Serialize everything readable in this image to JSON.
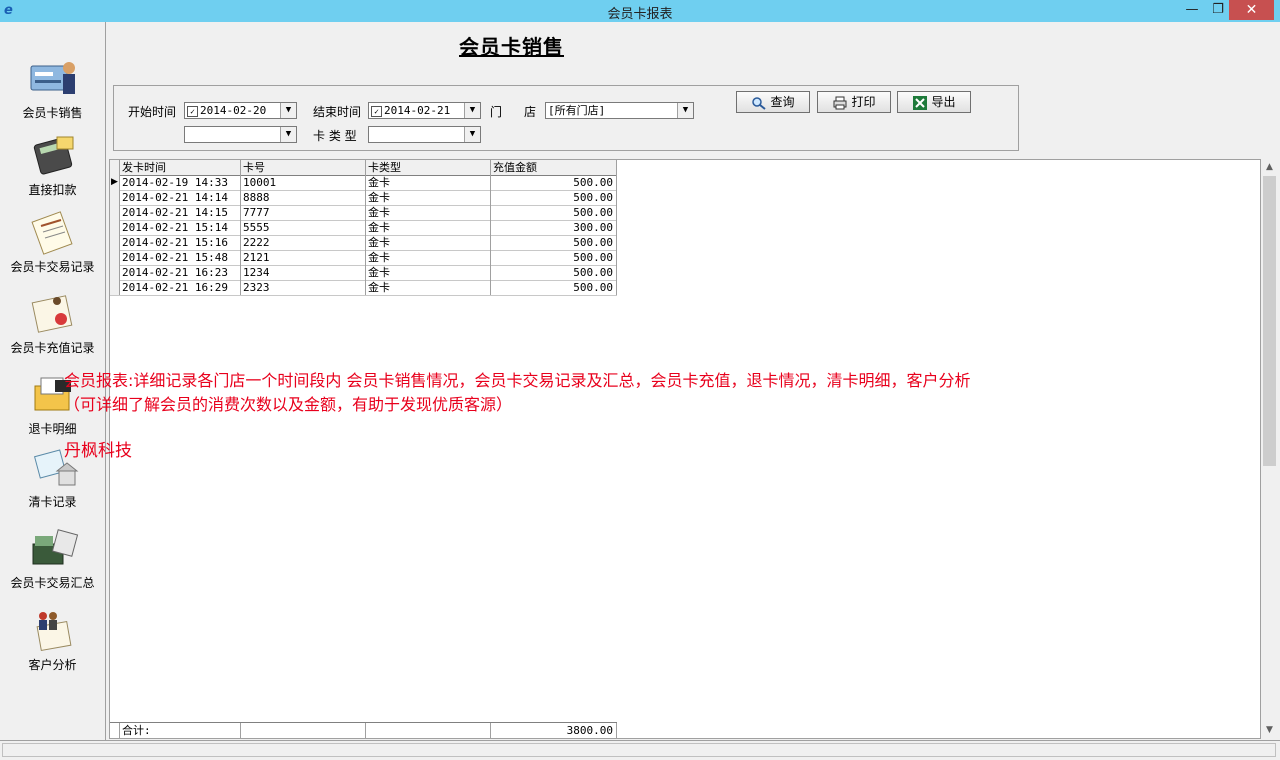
{
  "window": {
    "title": "会员卡报表",
    "minimize": "—",
    "restore": "❐",
    "close": "✕"
  },
  "sidebar": {
    "items": [
      {
        "label": "会员卡销售",
        "icon": "card-sale-icon"
      },
      {
        "label": "直接扣款",
        "icon": "calculator-icon"
      },
      {
        "label": "会员卡交易记录",
        "icon": "document-icon"
      },
      {
        "label": "会员卡充值记录",
        "icon": "certificate-icon"
      },
      {
        "label": "退卡明细",
        "icon": "folder-icon"
      },
      {
        "label": "清卡记录",
        "icon": "house-card-icon"
      },
      {
        "label": "会员卡交易汇总",
        "icon": "cash-register-icon"
      },
      {
        "label": "客户分析",
        "icon": "people-icon"
      }
    ]
  },
  "page_title": "会员卡销售",
  "filters": {
    "start_label": "开始时间",
    "start_value": "2014-02-20",
    "end_label": "结束时间",
    "end_value": "2014-02-21",
    "store_label_1": "门",
    "store_label_2": "店",
    "store_value": "[所有门店]",
    "card_type_label": "卡 类 型",
    "card_type_value": "",
    "extra_value": ""
  },
  "buttons": {
    "query": "查询",
    "print": "打印",
    "export": "导出"
  },
  "table": {
    "columns": [
      "发卡时间",
      "卡号",
      "卡类型",
      "充值金额"
    ],
    "rows": [
      [
        "2014-02-19 14:33",
        "10001",
        "金卡",
        "500.00"
      ],
      [
        "2014-02-21 14:14",
        "8888",
        "金卡",
        "500.00"
      ],
      [
        "2014-02-21 14:15",
        "7777",
        "金卡",
        "500.00"
      ],
      [
        "2014-02-21 15:14",
        "5555",
        "金卡",
        "300.00"
      ],
      [
        "2014-02-21 15:16",
        "2222",
        "金卡",
        "500.00"
      ],
      [
        "2014-02-21 15:48",
        "2121",
        "金卡",
        "500.00"
      ],
      [
        "2014-02-21 16:23",
        "1234",
        "金卡",
        "500.00"
      ],
      [
        "2014-02-21 16:29",
        "2323",
        "金卡",
        "500.00"
      ]
    ],
    "footer_label": "合计:",
    "footer_total": "3800.00"
  },
  "notes": {
    "line1": "会员报表:详细记录各门店一个时间段内 会员卡销售情况，会员卡交易记录及汇总，会员卡充值，退卡情况，清卡明细，客户分析",
    "line2": "（可详细了解会员的消费次数以及金额，有助于发现优质客源）",
    "company": "丹枫科技"
  },
  "colors": {
    "titlebar": "#6fcff0",
    "close": "#c75050",
    "note": "#e8001c"
  }
}
